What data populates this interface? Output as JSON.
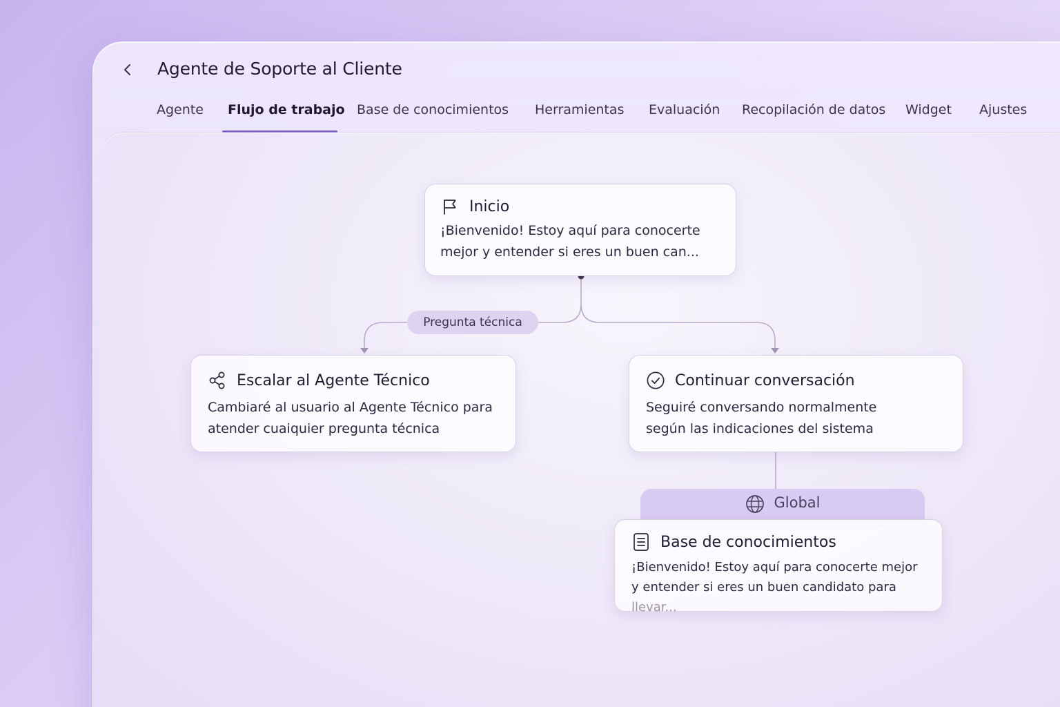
{
  "header": {
    "title": "Agente de Soporte al Cliente",
    "back_icon": "chevron-left-icon"
  },
  "tabs": [
    {
      "label": "Agente",
      "active": false
    },
    {
      "label": "Flujo de trabajo",
      "active": true
    },
    {
      "label": "Base de conocimientos",
      "active": false
    },
    {
      "label": "Herramientas",
      "active": false
    },
    {
      "label": "Evaluación",
      "active": false
    },
    {
      "label": "Recopilación de datos",
      "active": false
    },
    {
      "label": "Widget",
      "active": false
    },
    {
      "label": "Ajustes",
      "active": false
    }
  ],
  "workflow": {
    "start": {
      "icon": "flag-icon",
      "title": "Inicio",
      "line1": "¡Bienvenido! Estoy aquí para conocerte",
      "line2": "mejor y entender si eres un buen can..."
    },
    "edge_label": "Pregunta técnica",
    "escalate": {
      "icon": "share-icon",
      "title": "Escalar al Agente Técnico",
      "line1": "Cambiaré al usuario al Agente Técnico para",
      "line2": "atender cuaiquier pregunta técnica"
    },
    "continue": {
      "icon": "check-circle-icon",
      "title": "Continuar conversación",
      "line1": "Seguiré conversando normalmente",
      "line2": "según las indicaciones del sistema"
    },
    "global": {
      "icon": "globe-icon",
      "label": "Global"
    },
    "knowledge": {
      "icon": "document-icon",
      "title": "Base de conocimientos",
      "line1": "¡Bienvenido! Estoy aquí para conocerte mejor",
      "line2": "y entender si eres un buen candidato para",
      "line2_fade": "llevar..."
    }
  },
  "colors": {
    "accent": "#7a5bc8",
    "background": "#d9c9f4",
    "pill": "#ddd2ef",
    "global_tab": "#d8cbf1"
  }
}
